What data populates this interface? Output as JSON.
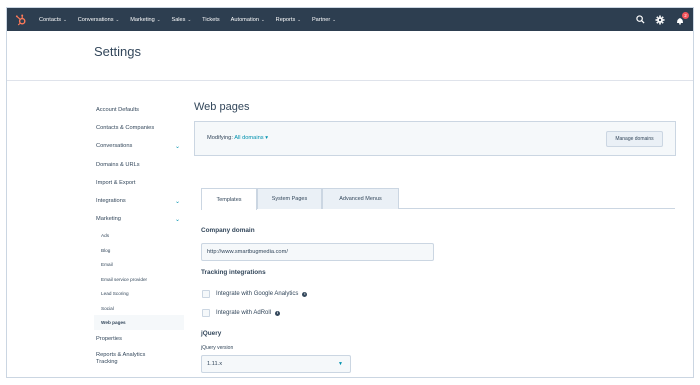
{
  "topnav": {
    "items": [
      {
        "label": "Contacts",
        "dropdown": true
      },
      {
        "label": "Conversations",
        "dropdown": true
      },
      {
        "label": "Marketing",
        "dropdown": true
      },
      {
        "label": "Sales",
        "dropdown": true
      },
      {
        "label": "Tickets",
        "dropdown": false
      },
      {
        "label": "Automation",
        "dropdown": true
      },
      {
        "label": "Reports",
        "dropdown": true
      },
      {
        "label": "Partner",
        "dropdown": true
      }
    ],
    "icons": [
      "search-icon",
      "gear-icon",
      "notifications-icon"
    ],
    "notification_count": "2",
    "colors": {
      "nav_bg": "#2d3e50",
      "logo": "#ff7a59",
      "badge": "#f2545b"
    }
  },
  "header": {
    "title": "Settings"
  },
  "sidebar": {
    "items": [
      {
        "label": "Account Defaults"
      },
      {
        "label": "Contacts & Companies"
      },
      {
        "label": "Conversations",
        "expandable": true
      },
      {
        "label": "Domains & URLs"
      },
      {
        "label": "Import & Export"
      },
      {
        "label": "Integrations",
        "expandable": true
      },
      {
        "label": "Marketing",
        "expandable": true,
        "expanded": true
      }
    ],
    "marketing_sub": [
      "Ads",
      "Blog",
      "Email",
      "Email service provider",
      "Lead Scoring",
      "Social",
      "Web pages"
    ],
    "active_sub": "Web pages",
    "after": [
      "Properties",
      "Reports & Analytics Tracking"
    ]
  },
  "main": {
    "title": "Web pages",
    "modifying_label": "Modifying:",
    "modifying_value": "All domains",
    "manage_domains": "Manage domains",
    "tabs": [
      "Templates",
      "System Pages",
      "Advanced Menus"
    ],
    "active_tab": "Templates",
    "company_domain_title": "Company domain",
    "company_domain_value": "http://www.smartbugmedia.com/",
    "tracking_title": "Tracking integrations",
    "google_analytics_label": "Integrate with Google Analytics",
    "adroll_label": "Integrate with AdRoll",
    "jquery_title": "jQuery",
    "jquery_version_label": "jQuery version",
    "jquery_version_value": "1.11.x",
    "accent": "#0091ae"
  }
}
